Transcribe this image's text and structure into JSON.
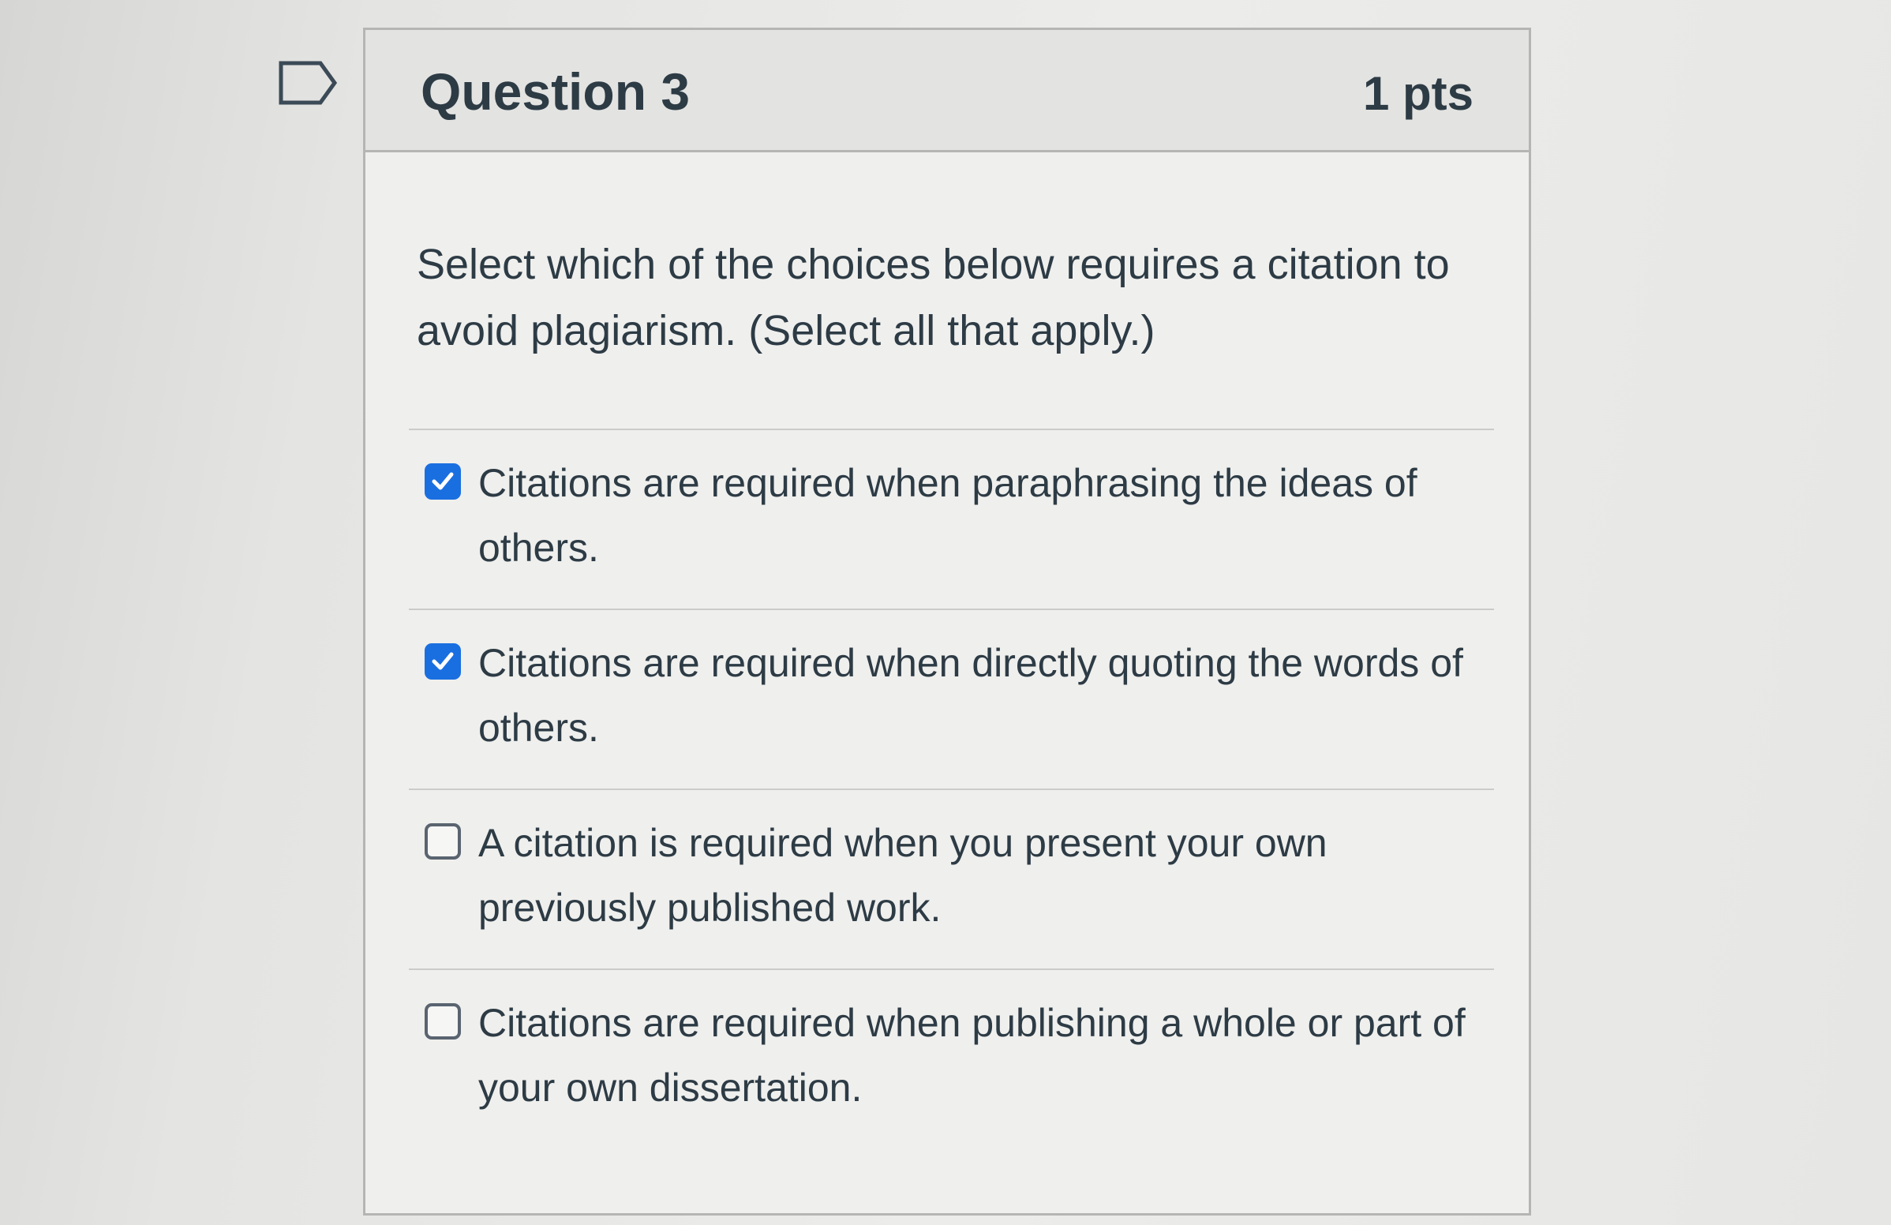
{
  "question": {
    "title": "Question 3",
    "points": "1 pts",
    "text": "Select which of the choices below requires a citation to avoid plagiarism. (Select all that apply.)",
    "flag_icon": "bookmark-flag-icon"
  },
  "colors": {
    "checked_accent": "#1a6fe0",
    "text": "#2d3b45",
    "header_bg": "#e3e3e1"
  },
  "answers": [
    {
      "label": "Citations are required when paraphrasing the ideas of others.",
      "checked": true
    },
    {
      "label": "Citations are required when directly quoting the words of others.",
      "checked": true
    },
    {
      "label": "A citation is required when you present your own previously published work.",
      "checked": false
    },
    {
      "label": "Citations are required when publishing a whole or part of your own dissertation.",
      "checked": false
    }
  ]
}
